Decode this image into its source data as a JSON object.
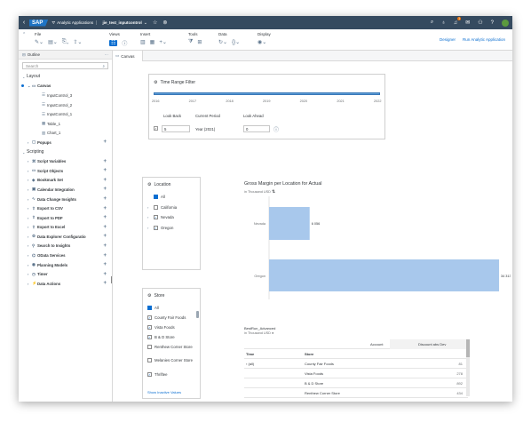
{
  "shell": {
    "app_title": "Analytic Applications",
    "doc_title": "jie_test_inputcontrol",
    "notification_count": "1"
  },
  "toolbar": {
    "groups": [
      {
        "label": "File"
      },
      {
        "label": "Views"
      },
      {
        "label": "Insert"
      },
      {
        "label": "Tools"
      },
      {
        "label": "Data"
      },
      {
        "label": "Display"
      }
    ],
    "designer_label": "Designer",
    "run_label": "Run Analytic Application"
  },
  "outline": {
    "title": "Outline",
    "search_placeholder": "Search",
    "layout_label": "Layout",
    "canvas_label": "Canvas",
    "widgets": [
      "InputControl_3",
      "InputControl_2",
      "InputControl_1",
      "Table_1",
      "Chart_1"
    ],
    "popups_label": "Popups",
    "scripting_label": "Scripting",
    "scripting_items": [
      "Script Variables",
      "Script Objects",
      "Bookmark Set",
      "Calendar Integration",
      "Data Change Insights",
      "Export to CSV",
      "Export to PDF",
      "Export to Excel",
      "Data Explorer Configuratio",
      "Search to Insights",
      "OData Services",
      "Planning Models",
      "Timer",
      "Data Actions"
    ]
  },
  "tab": {
    "label": "Canvas"
  },
  "range_filter": {
    "title": "Time Range Filter",
    "years": [
      "2016",
      "2017",
      "2018",
      "2019",
      "2020",
      "2021",
      "2022"
    ],
    "look_back_label": "Look Back",
    "current_period_label": "Current Period",
    "look_ahead_label": "Look Ahead",
    "look_back_value": "5",
    "current_period_value": "Year (2021)",
    "look_ahead_value": "0"
  },
  "location_control": {
    "title": "Location",
    "items": [
      {
        "label": "All",
        "state": "partial"
      },
      {
        "label": "California",
        "state": "unchecked"
      },
      {
        "label": "Nevada",
        "state": "checked"
      },
      {
        "label": "Oregon",
        "state": "checked"
      }
    ]
  },
  "store_control": {
    "title": "Store",
    "items": [
      {
        "label": "All",
        "state": "partial"
      },
      {
        "label": "County Fair Foods",
        "state": "checked"
      },
      {
        "label": "Vista Foods",
        "state": "checked"
      },
      {
        "label": "B & D Store",
        "state": "checked"
      },
      {
        "label": "Renthew Corner Store",
        "state": "unchecked"
      },
      {
        "label": "Melanies Corner Store",
        "state": "unchecked"
      },
      {
        "label": "Thriftee",
        "state": "checked"
      }
    ],
    "show_inactive": "Show Inactive Values"
  },
  "chart": {
    "title": "Gross Margin per Location for Actual",
    "subtitle": "in Thousand USD"
  },
  "chart_data": {
    "type": "bar",
    "orientation": "horizontal",
    "title": "Gross Margin per Location for Actual",
    "subtitle": "in Thousand USD",
    "categories": [
      "Nevada",
      "Oregon"
    ],
    "values": [
      6056,
      34313
    ],
    "value_labels": [
      "6 056",
      "34 313"
    ],
    "color": "#a8c8ec",
    "xlim": [
      0,
      35500
    ]
  },
  "table": {
    "title": "BestRun_Advanced",
    "subtitle": "in Thousand USD",
    "account_header": "Account",
    "measure_header": "Discount abs Dev",
    "time_header": "Time",
    "store_header": "Store",
    "time_value": "(all)",
    "rows": [
      {
        "store": "County Fair Foods",
        "value": "81"
      },
      {
        "store": "Vista Foods",
        "value": "278"
      },
      {
        "store": "B & D Store",
        "value": "892"
      },
      {
        "store": "Renthew Corner Store",
        "value": "434"
      },
      {
        "store": "Thriftee",
        "value": "512"
      }
    ]
  }
}
